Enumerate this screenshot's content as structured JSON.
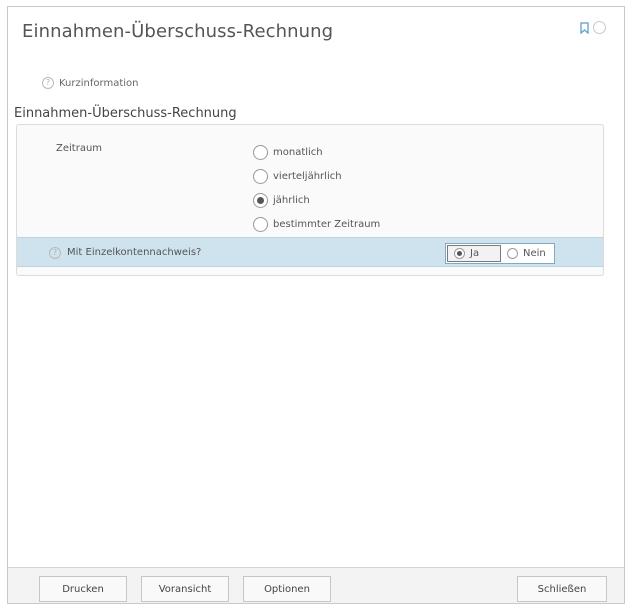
{
  "dialog": {
    "title": "Einnahmen-Überschuss-Rechnung",
    "icons": [
      "bookmark-icon",
      "circle-icon"
    ]
  },
  "kurzinfo": {
    "label": "Kurzinformation",
    "icon": "help-icon"
  },
  "section": {
    "heading": "Einnahmen-Überschuss-Rechnung"
  },
  "zeitraum": {
    "label": "Zeitraum",
    "options": [
      "monatlich",
      "vierteljährlich",
      "jährlich",
      "bestimmter Zeitraum"
    ],
    "selected": "jährlich"
  },
  "einzelkonten": {
    "label": "Mit Einzelkontennachweis?",
    "options": [
      "Ja",
      "Nein"
    ],
    "selected": "Ja"
  },
  "footer": {
    "drucken": "Drucken",
    "voransicht": "Voransicht",
    "optionen": "Optionen",
    "schliessen": "Schließen"
  }
}
